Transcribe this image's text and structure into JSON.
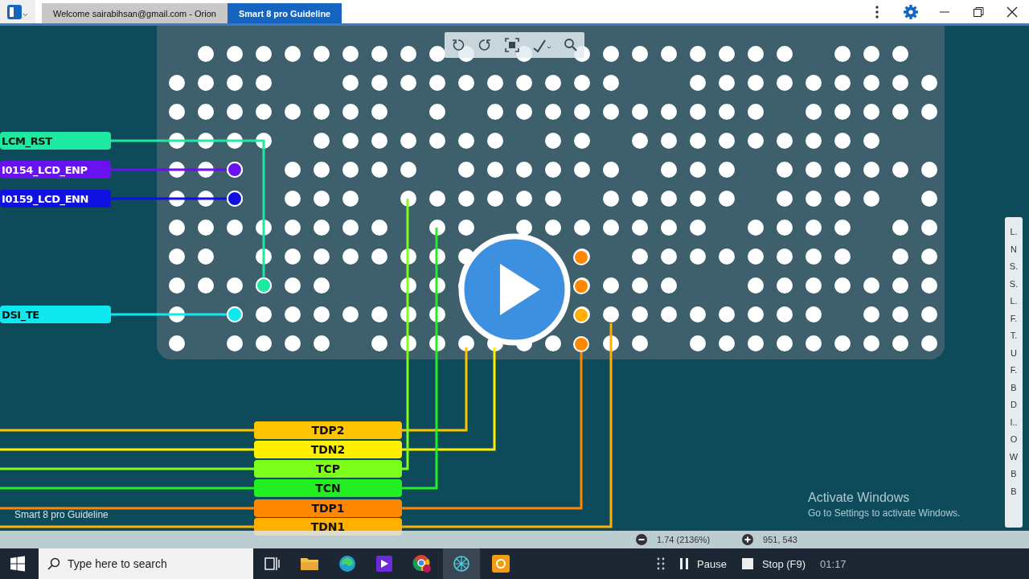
{
  "window": {
    "tabs": [
      {
        "label": "Welcome sairabihsan@gmail.com - Orion",
        "selected": false
      },
      {
        "label": "Smart 8 pro Guideline",
        "selected": true
      }
    ]
  },
  "left_signals": [
    {
      "label": "LCM_RST",
      "color": "#1de9a0"
    },
    {
      "label": "I0154_LCD_ENP",
      "color": "#6a11f0"
    },
    {
      "label": "I0159_LCD_ENN",
      "color": "#1010e0"
    },
    {
      "label": "DSI_TE",
      "color": "#10e8f0"
    }
  ],
  "bottom_signals": [
    {
      "label": "TDP2",
      "color": "#ffc400"
    },
    {
      "label": "TDN2",
      "color": "#fff000"
    },
    {
      "label": "TCP",
      "color": "#7cff1a"
    },
    {
      "label": "TCN",
      "color": "#22ee22"
    },
    {
      "label": "TDP1",
      "color": "#ff8800"
    },
    {
      "label": "TDN1",
      "color": "#ffb000"
    }
  ],
  "canvas_caption": "Smart 8 pro Guideline",
  "side_index": [
    "L.",
    "N",
    "S.",
    "S.",
    "L.",
    "F.",
    "T.",
    "U",
    "F.",
    "B",
    "D",
    "I..",
    "O",
    "W",
    "B",
    "B"
  ],
  "activation": {
    "title": "Activate Windows",
    "hint": "Go to Settings to activate Windows."
  },
  "status_bar": {
    "zoom": "1.74 (2136%)",
    "coords": "951, 543"
  },
  "taskbar": {
    "search_placeholder": "Type here to search"
  },
  "recorder": {
    "pause": "Pause",
    "stop": "Stop (F9)",
    "time": "01:17"
  }
}
